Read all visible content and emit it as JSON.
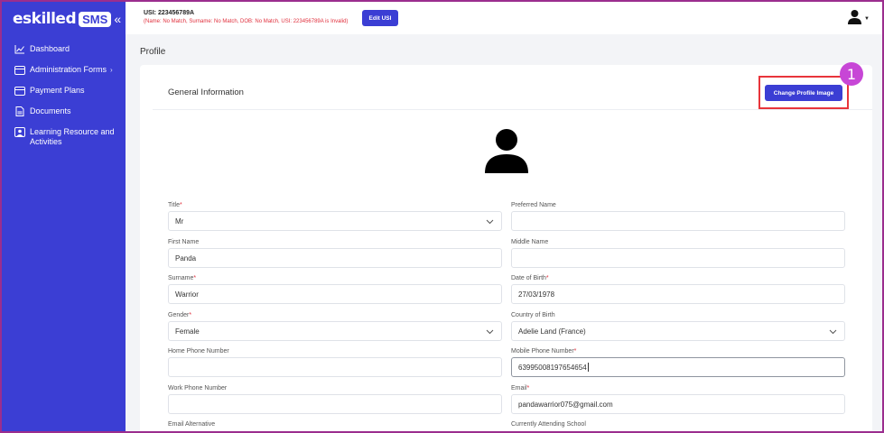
{
  "brand": {
    "name": "eskilled",
    "badge": "SMS",
    "collapse_icon": "«"
  },
  "sidebar": {
    "items": [
      {
        "label": "Dashboard",
        "icon": "chart-line-icon"
      },
      {
        "label": "Administration Forms",
        "icon": "card-icon",
        "has_children": true
      },
      {
        "label": "Payment Plans",
        "icon": "card-icon"
      },
      {
        "label": "Documents",
        "icon": "document-icon"
      },
      {
        "label": "Learning Resource and Activities",
        "icon": "user-screen-icon"
      }
    ]
  },
  "topbar": {
    "usi_title": "USI: 223456789A",
    "usi_status": "(Name: No Match, Surname: No Match, DOB: No Match, USI: 223456789A is Invalid)",
    "edit_usi_label": "Edit USI"
  },
  "page": {
    "title": "Profile"
  },
  "card": {
    "title": "General Information",
    "change_image_label": "Change Profile Image",
    "step_number": "1"
  },
  "form": {
    "title": {
      "label": "Title",
      "value": "Mr"
    },
    "preferred_name": {
      "label": "Preferred Name",
      "value": ""
    },
    "first_name": {
      "label": "First Name",
      "value": "Panda"
    },
    "middle_name": {
      "label": "Middle Name",
      "value": ""
    },
    "surname": {
      "label": "Surname",
      "value": "Warrior"
    },
    "dob": {
      "label": "Date of Birth",
      "value": "27/03/1978"
    },
    "gender": {
      "label": "Gender",
      "value": "Female"
    },
    "country_of_birth": {
      "label": "Country of Birth",
      "value": "Adelie Land (France)"
    },
    "home_phone": {
      "label": "Home Phone Number",
      "value": ""
    },
    "mobile_phone": {
      "label": "Mobile Phone Number",
      "value": "63995008197654654"
    },
    "work_phone": {
      "label": "Work Phone Number",
      "value": ""
    },
    "email": {
      "label": "Email",
      "value": "pandawarrior075@gmail.com"
    },
    "email_alt": {
      "label": "Email Alternative"
    },
    "school": {
      "label": "Currently Attending School"
    }
  },
  "colors": {
    "accent": "#3b3ed4",
    "required": "#e02f3c",
    "highlight": "#e8353b",
    "badge": "#c746d6"
  }
}
